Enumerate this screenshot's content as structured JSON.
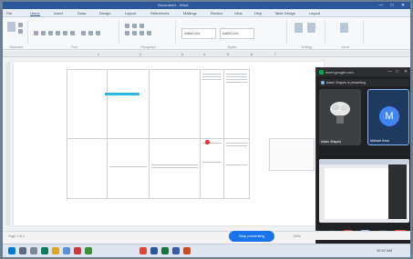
{
  "word": {
    "doc_title": "Document1 - Word",
    "tabs": [
      "File",
      "Home",
      "Insert",
      "Draw",
      "Design",
      "Layout",
      "References",
      "Mailings",
      "Review",
      "View",
      "Help",
      "Table Design",
      "Layout"
    ],
    "active_tab_index": 1,
    "ribbon_groups": [
      "Clipboard",
      "Font",
      "Paragraph",
      "Styles",
      "Editing",
      "Voice"
    ],
    "style_samples": [
      "AaBbCcDd",
      "AaBbCcDd"
    ],
    "window_controls": [
      "—",
      "□",
      "✕"
    ]
  },
  "ruler_ticks": [
    "1",
    "2",
    "3",
    "4",
    "5",
    "6",
    "7"
  ],
  "meet": {
    "url": "meet.google.com",
    "subtitle": "Adam Shapiro is presenting",
    "participants": [
      {
        "name": "Adam Shapiro",
        "avatar": ""
      },
      {
        "name": "Michael Kess",
        "avatar": "M"
      }
    ],
    "controls": {
      "mic": "🎤",
      "cam": "📷",
      "present": "⬆",
      "more": "⋮",
      "end": "☎"
    },
    "window_controls": [
      "—",
      "□",
      "✕"
    ]
  },
  "share_pill": "Stop presenting",
  "statusbar": {
    "left": "Page 1 of 1",
    "right": "100%"
  },
  "taskbar": {
    "clock": "10:42 AM"
  },
  "colors": {
    "word_blue": "#2b579a",
    "meet_dark": "#202124",
    "end_red": "#ea4335",
    "accent_blue": "#1a73e8"
  }
}
